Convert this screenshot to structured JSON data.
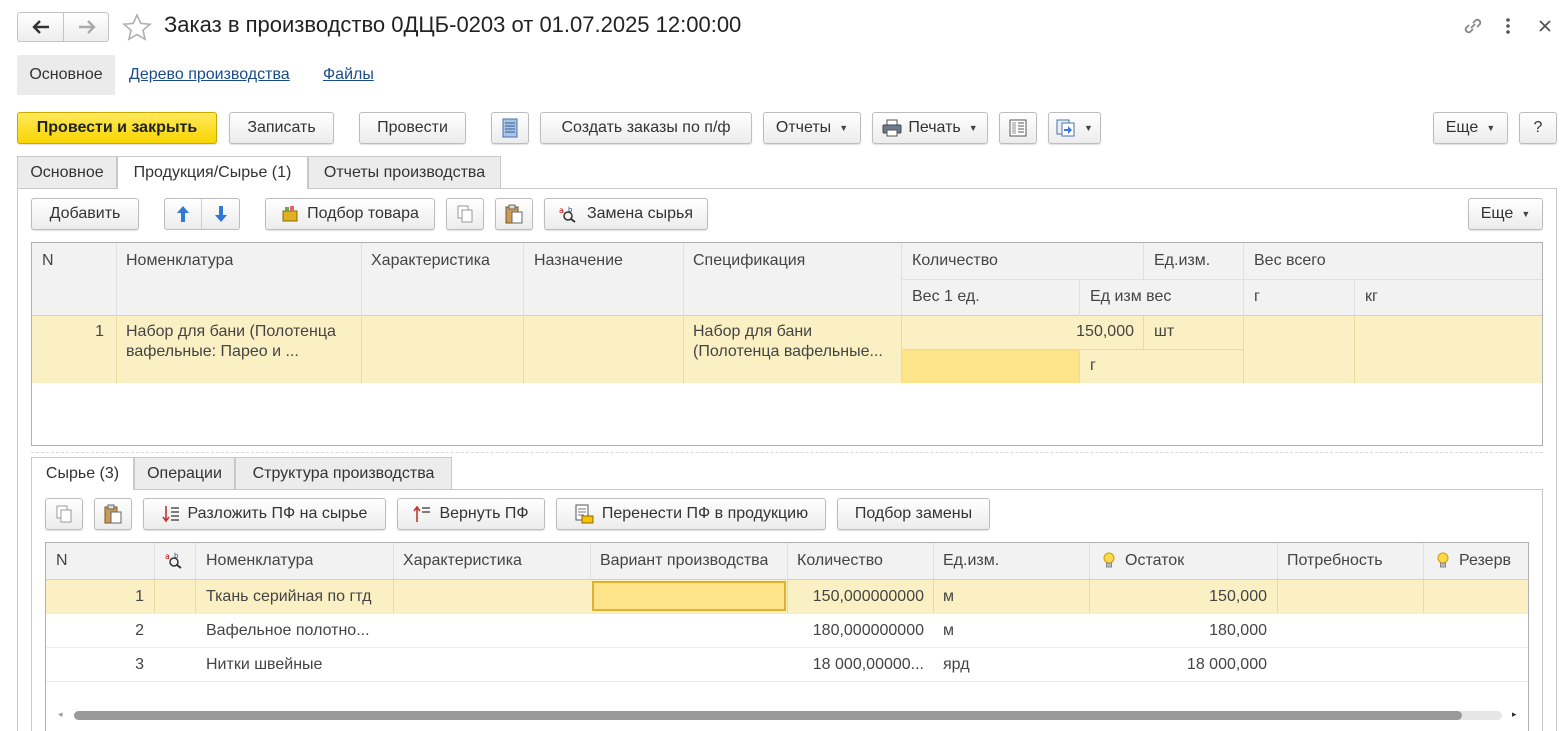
{
  "window": {
    "title": "Заказ в производство 0ДЦБ-0203 от 01.07.2025 12:00:00"
  },
  "nav": {
    "main": "Основное",
    "tree": "Дерево производства",
    "files": "Файлы"
  },
  "toolbar": {
    "post_close": "Провести и закрыть",
    "save": "Записать",
    "post": "Провести",
    "create_orders": "Создать заказы по п/ф",
    "reports": "Отчеты",
    "print": "Печать",
    "more": "Еще",
    "help": "?"
  },
  "tabs": [
    "Основное",
    "Продукция/Сырье (1)",
    "Отчеты производства"
  ],
  "product_toolbar": {
    "add": "Добавить",
    "pick": "Подбор товара",
    "replace": "Замена сырья",
    "more": "Еще"
  },
  "product_table": {
    "headers": {
      "n": "N",
      "nomenclature": "Номенклатура",
      "characteristic": "Характеристика",
      "purpose": "Назначение",
      "spec": "Спецификация",
      "qty": "Количество",
      "unit": "Ед.изм.",
      "weight_total": "Вес всего",
      "weight_per": "Вес 1 ед.",
      "weight_unit": "Ед изм вес",
      "g": "г",
      "kg": "кг"
    },
    "rows": [
      {
        "n": "1",
        "nomenclature_l1": "Набор для бани (Полотенца",
        "nomenclature_l2": "вафельные: Парео и ...",
        "spec_l1": "Набор для бани",
        "spec_l2": "(Полотенца вафельные...",
        "qty": "150,000",
        "unit": "шт",
        "weight_unit": "г"
      }
    ]
  },
  "sub_tabs": [
    "Сырье (3)",
    "Операции",
    "Структура производства"
  ],
  "raw_toolbar": {
    "decompose": "Разложить ПФ на сырье",
    "return": "Вернуть ПФ",
    "transfer": "Перенести ПФ в продукцию",
    "pick_replace": "Подбор замены"
  },
  "raw_table": {
    "headers": {
      "n": "N",
      "nomenclature": "Номенклатура",
      "characteristic": "Характеристика",
      "variant": "Вариант производства",
      "qty": "Количество",
      "unit": "Ед.изм.",
      "stock": "Остаток",
      "need": "Потребность",
      "reserve": "Резерв"
    },
    "rows": [
      {
        "n": "1",
        "nomenclature": "Ткань серийная по гтд",
        "qty": "150,000000000",
        "unit": "м",
        "stock": "150,000"
      },
      {
        "n": "2",
        "nomenclature": "Вафельное полотно...",
        "qty": "180,000000000",
        "unit": "м",
        "stock": "180,000"
      },
      {
        "n": "3",
        "nomenclature": "Нитки швейные",
        "qty": "18 000,00000...",
        "unit": "ярд",
        "stock": "18 000,000"
      }
    ]
  },
  "colors": {
    "accent_yellow": "#f7d500",
    "selected_row": "#fbf0c4",
    "active_cell": "#fde38a",
    "link": "#1a4c8c"
  }
}
